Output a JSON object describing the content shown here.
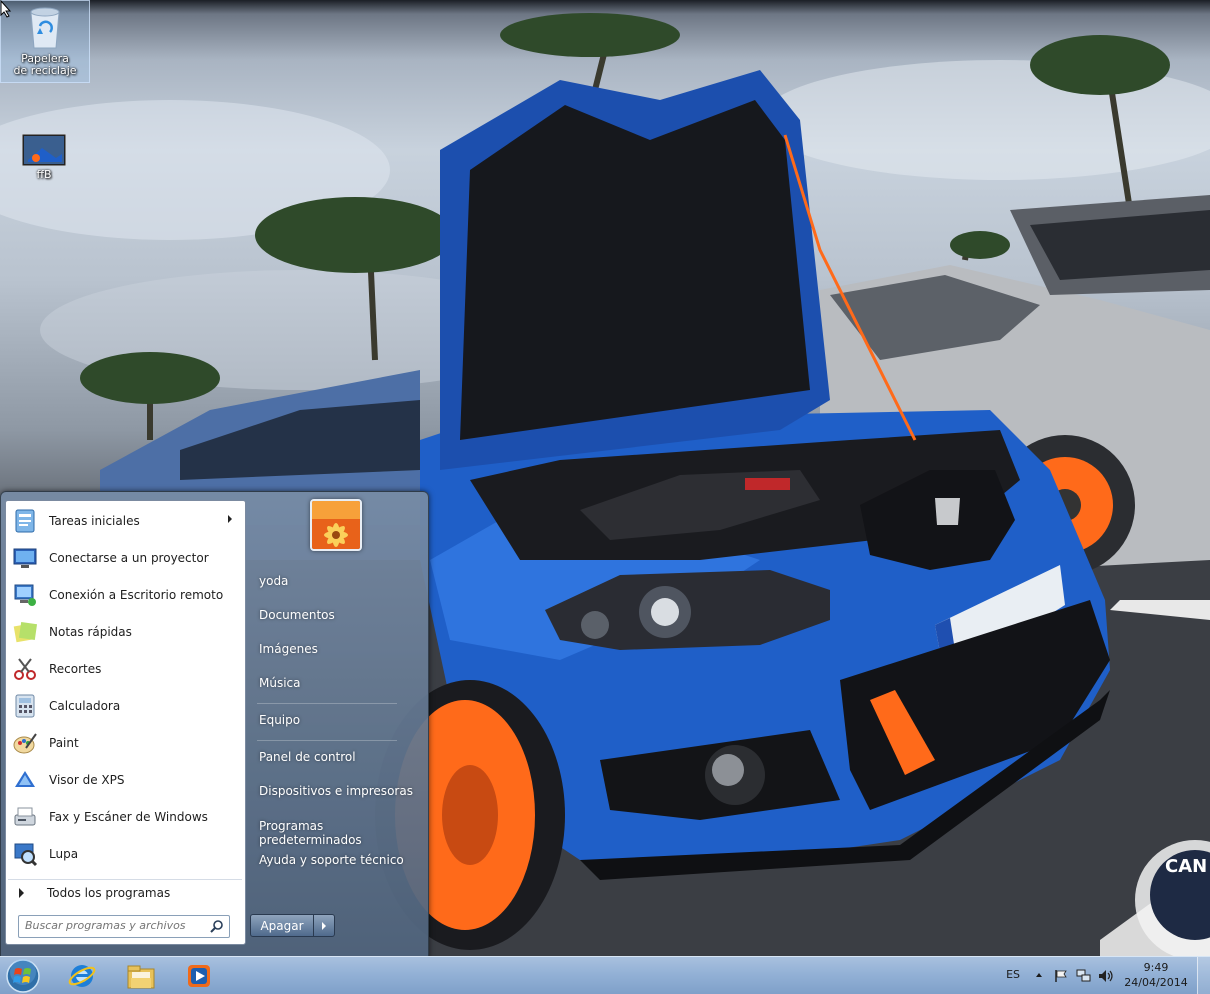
{
  "desktop": {
    "icons": [
      {
        "label": "Papelera de reciclaje",
        "icon": "recycle-bin-icon"
      },
      {
        "label": "ffB",
        "icon": "image-file-icon"
      }
    ],
    "watermark_text": "CAN"
  },
  "start_menu": {
    "programs": [
      {
        "label": "Tareas iniciales",
        "icon": "getting-started-icon",
        "has_submenu": true
      },
      {
        "label": "Conectarse a un proyector",
        "icon": "projector-icon"
      },
      {
        "label": "Conexión a Escritorio remoto",
        "icon": "remote-desktop-icon"
      },
      {
        "label": "Notas rápidas",
        "icon": "sticky-notes-icon"
      },
      {
        "label": "Recortes",
        "icon": "snipping-tool-icon"
      },
      {
        "label": "Calculadora",
        "icon": "calculator-icon"
      },
      {
        "label": "Paint",
        "icon": "paint-icon"
      },
      {
        "label": "Visor de XPS",
        "icon": "xps-viewer-icon"
      },
      {
        "label": "Fax y Escáner de Windows",
        "icon": "fax-scanner-icon"
      },
      {
        "label": "Lupa",
        "icon": "magnifier-icon"
      }
    ],
    "all_programs_label": "Todos los programas",
    "search_placeholder": "Buscar programas y archivos",
    "right_items": {
      "user": "yoda",
      "documents": "Documentos",
      "pictures": "Imágenes",
      "music": "Música",
      "computer": "Equipo",
      "control_panel": "Panel de control",
      "devices": "Dispositivos e impresoras",
      "default_programs": "Programas predeterminados",
      "help": "Ayuda y soporte técnico"
    },
    "shutdown_label": "Apagar"
  },
  "taskbar": {
    "pinned": [
      "start-orb-icon",
      "internet-explorer-icon",
      "file-explorer-icon",
      "media-player-icon"
    ],
    "tray": {
      "language": "ES",
      "time": "9:49",
      "date": "24/04/2014"
    }
  },
  "colors": {
    "taskbar": "#93b1d6",
    "start_menu_right": "#5f7896",
    "car_blue": "#1f5fc8",
    "wheel_orange": "#ff6a1a"
  }
}
